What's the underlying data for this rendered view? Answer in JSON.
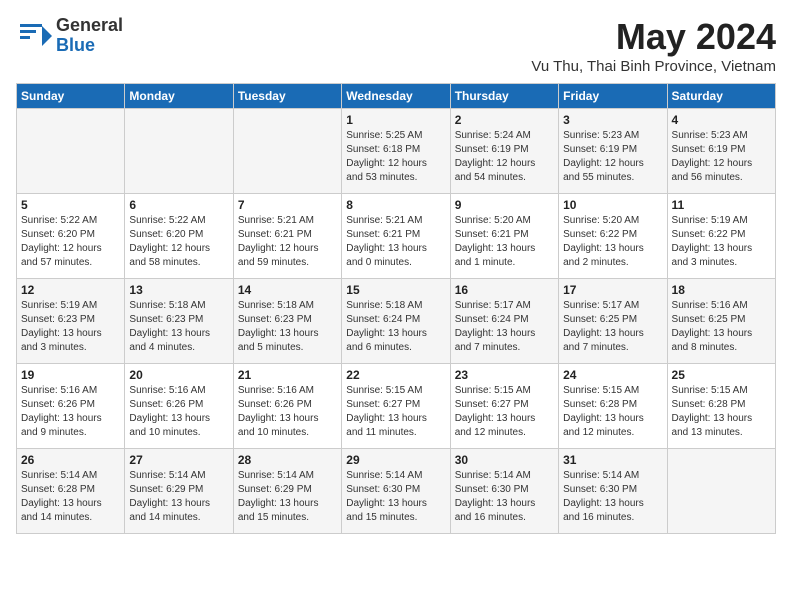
{
  "app": {
    "logo_line1": "General",
    "logo_line2": "Blue",
    "title": "May 2024",
    "subtitle": "Vu Thu, Thai Binh Province, Vietnam"
  },
  "calendar": {
    "headers": [
      "Sunday",
      "Monday",
      "Tuesday",
      "Wednesday",
      "Thursday",
      "Friday",
      "Saturday"
    ],
    "rows": [
      [
        {
          "num": "",
          "info": ""
        },
        {
          "num": "",
          "info": ""
        },
        {
          "num": "",
          "info": ""
        },
        {
          "num": "1",
          "info": "Sunrise: 5:25 AM\nSunset: 6:18 PM\nDaylight: 12 hours\nand 53 minutes."
        },
        {
          "num": "2",
          "info": "Sunrise: 5:24 AM\nSunset: 6:19 PM\nDaylight: 12 hours\nand 54 minutes."
        },
        {
          "num": "3",
          "info": "Sunrise: 5:23 AM\nSunset: 6:19 PM\nDaylight: 12 hours\nand 55 minutes."
        },
        {
          "num": "4",
          "info": "Sunrise: 5:23 AM\nSunset: 6:19 PM\nDaylight: 12 hours\nand 56 minutes."
        }
      ],
      [
        {
          "num": "5",
          "info": "Sunrise: 5:22 AM\nSunset: 6:20 PM\nDaylight: 12 hours\nand 57 minutes."
        },
        {
          "num": "6",
          "info": "Sunrise: 5:22 AM\nSunset: 6:20 PM\nDaylight: 12 hours\nand 58 minutes."
        },
        {
          "num": "7",
          "info": "Sunrise: 5:21 AM\nSunset: 6:21 PM\nDaylight: 12 hours\nand 59 minutes."
        },
        {
          "num": "8",
          "info": "Sunrise: 5:21 AM\nSunset: 6:21 PM\nDaylight: 13 hours\nand 0 minutes."
        },
        {
          "num": "9",
          "info": "Sunrise: 5:20 AM\nSunset: 6:21 PM\nDaylight: 13 hours\nand 1 minute."
        },
        {
          "num": "10",
          "info": "Sunrise: 5:20 AM\nSunset: 6:22 PM\nDaylight: 13 hours\nand 2 minutes."
        },
        {
          "num": "11",
          "info": "Sunrise: 5:19 AM\nSunset: 6:22 PM\nDaylight: 13 hours\nand 3 minutes."
        }
      ],
      [
        {
          "num": "12",
          "info": "Sunrise: 5:19 AM\nSunset: 6:23 PM\nDaylight: 13 hours\nand 3 minutes."
        },
        {
          "num": "13",
          "info": "Sunrise: 5:18 AM\nSunset: 6:23 PM\nDaylight: 13 hours\nand 4 minutes."
        },
        {
          "num": "14",
          "info": "Sunrise: 5:18 AM\nSunset: 6:23 PM\nDaylight: 13 hours\nand 5 minutes."
        },
        {
          "num": "15",
          "info": "Sunrise: 5:18 AM\nSunset: 6:24 PM\nDaylight: 13 hours\nand 6 minutes."
        },
        {
          "num": "16",
          "info": "Sunrise: 5:17 AM\nSunset: 6:24 PM\nDaylight: 13 hours\nand 7 minutes."
        },
        {
          "num": "17",
          "info": "Sunrise: 5:17 AM\nSunset: 6:25 PM\nDaylight: 13 hours\nand 7 minutes."
        },
        {
          "num": "18",
          "info": "Sunrise: 5:16 AM\nSunset: 6:25 PM\nDaylight: 13 hours\nand 8 minutes."
        }
      ],
      [
        {
          "num": "19",
          "info": "Sunrise: 5:16 AM\nSunset: 6:26 PM\nDaylight: 13 hours\nand 9 minutes."
        },
        {
          "num": "20",
          "info": "Sunrise: 5:16 AM\nSunset: 6:26 PM\nDaylight: 13 hours\nand 10 minutes."
        },
        {
          "num": "21",
          "info": "Sunrise: 5:16 AM\nSunset: 6:26 PM\nDaylight: 13 hours\nand 10 minutes."
        },
        {
          "num": "22",
          "info": "Sunrise: 5:15 AM\nSunset: 6:27 PM\nDaylight: 13 hours\nand 11 minutes."
        },
        {
          "num": "23",
          "info": "Sunrise: 5:15 AM\nSunset: 6:27 PM\nDaylight: 13 hours\nand 12 minutes."
        },
        {
          "num": "24",
          "info": "Sunrise: 5:15 AM\nSunset: 6:28 PM\nDaylight: 13 hours\nand 12 minutes."
        },
        {
          "num": "25",
          "info": "Sunrise: 5:15 AM\nSunset: 6:28 PM\nDaylight: 13 hours\nand 13 minutes."
        }
      ],
      [
        {
          "num": "26",
          "info": "Sunrise: 5:14 AM\nSunset: 6:28 PM\nDaylight: 13 hours\nand 14 minutes."
        },
        {
          "num": "27",
          "info": "Sunrise: 5:14 AM\nSunset: 6:29 PM\nDaylight: 13 hours\nand 14 minutes."
        },
        {
          "num": "28",
          "info": "Sunrise: 5:14 AM\nSunset: 6:29 PM\nDaylight: 13 hours\nand 15 minutes."
        },
        {
          "num": "29",
          "info": "Sunrise: 5:14 AM\nSunset: 6:30 PM\nDaylight: 13 hours\nand 15 minutes."
        },
        {
          "num": "30",
          "info": "Sunrise: 5:14 AM\nSunset: 6:30 PM\nDaylight: 13 hours\nand 16 minutes."
        },
        {
          "num": "31",
          "info": "Sunrise: 5:14 AM\nSunset: 6:30 PM\nDaylight: 13 hours\nand 16 minutes."
        },
        {
          "num": "",
          "info": ""
        }
      ]
    ]
  }
}
